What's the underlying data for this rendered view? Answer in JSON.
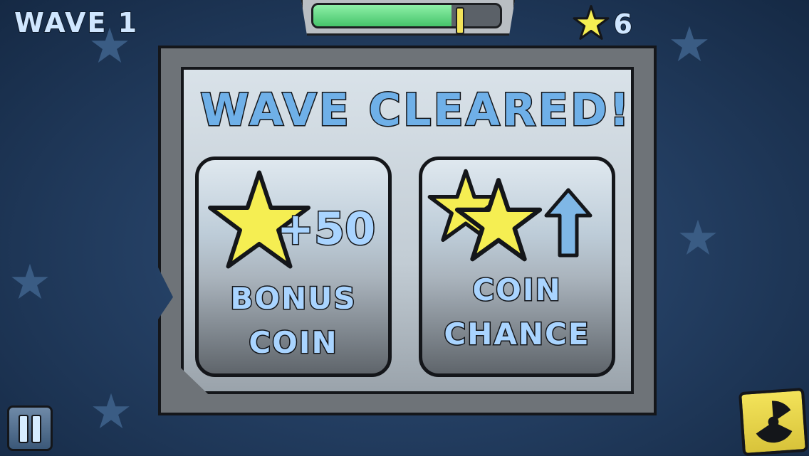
{
  "hud": {
    "wave_label": "WAVE 1",
    "star_count": "6",
    "health_fraction": 0.74
  },
  "panel": {
    "title": "WAVE CLEARED!",
    "cards": [
      {
        "name": "bonus-coin",
        "line1": "BONUS",
        "line2": "COIN",
        "amount": "+50",
        "icon": "star-icon"
      },
      {
        "name": "coin-chance",
        "line1": "COIN",
        "line2": "CHANCE",
        "icon": "up-arrow-icon"
      }
    ]
  },
  "controls": {
    "pause_icon": "pause-icon",
    "nuke_icon": "radiation-icon"
  },
  "colors": {
    "background": "#243f63",
    "star_yellow": "#f5ee52",
    "label_blue": "#a9d4ff",
    "title_blue": "#6fb0e8",
    "health_green": "#46c46a"
  }
}
